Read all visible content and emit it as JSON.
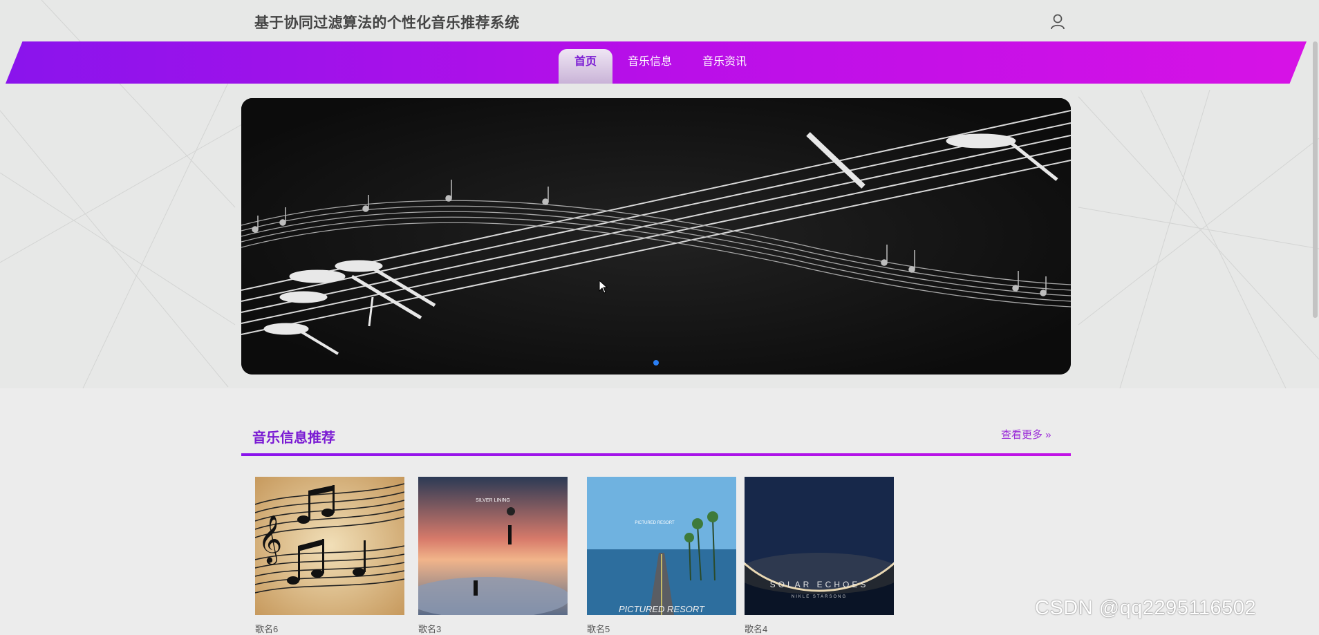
{
  "header": {
    "title": "基于协同过滤算法的个性化音乐推荐系统",
    "user_icon": "user-icon"
  },
  "nav": {
    "items": [
      {
        "label": "首页",
        "active": true
      },
      {
        "label": "音乐信息",
        "active": false
      },
      {
        "label": "音乐资讯",
        "active": false
      }
    ]
  },
  "banner": {
    "slides_count": 1,
    "active_slide": 1
  },
  "section": {
    "title": "音乐信息推荐",
    "more_label": "查看更多"
  },
  "songs": [
    {
      "name": "歌名6"
    },
    {
      "name": "歌名3"
    },
    {
      "name": "歌名5"
    },
    {
      "name": "歌名4"
    }
  ],
  "covers": {
    "song3_text": "SILVER LINING",
    "song4_text": "SOLAR ECHOES",
    "song4_subtext": "NIKLE STARSONG",
    "song5_text": "PICTURED RESORT"
  },
  "watermark": "CSDN @qq2295116502",
  "colors": {
    "accent": "#7a1ad3",
    "nav_start": "#8a14ec",
    "nav_end": "#d712e6",
    "dot": "#2a7ff5"
  }
}
